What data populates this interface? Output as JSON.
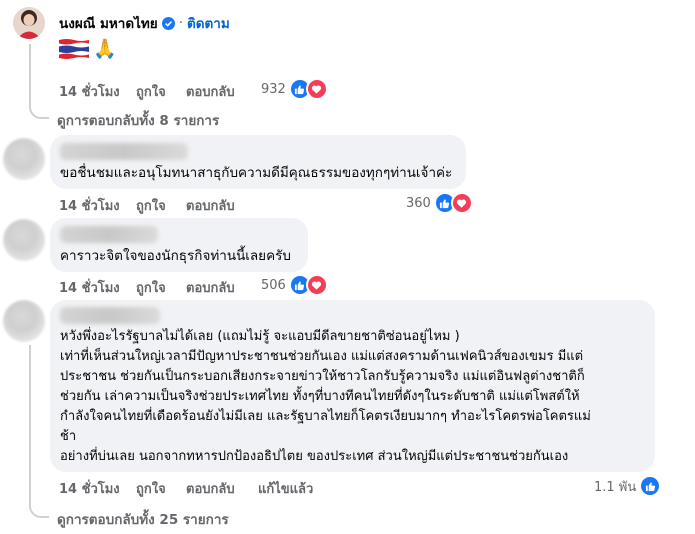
{
  "top_comment": {
    "author": "นงผณี มหาดไทย",
    "follow_label": "ติดตาม",
    "separator": "·",
    "emoji_text": "🙏",
    "time": "14 ชั่วโมง",
    "like_label": "ถูกใจ",
    "reply_label": "ตอบกลับ",
    "reactions_count": "932",
    "view_replies": "ดูการตอบกลับทั้ง 8 รายการ"
  },
  "replies": [
    {
      "text": "ขอชื่นชมและอนุโมทนาสาธุกับความดีมีคุณธรรมของทุกๆท่านเจ้าค่ะ",
      "time": "14 ชั่วโมง",
      "like_label": "ถูกใจ",
      "reply_label": "ตอบกลับ",
      "reactions_count": "360"
    },
    {
      "text": "คาราวะจิตใจของนักธุรกิจท่านนี้เลยครับ",
      "time": "14 ชั่วโมง",
      "like_label": "ถูกใจ",
      "reply_label": "ตอบกลับ",
      "reactions_count": "506"
    },
    {
      "lines": [
        "หวังพึ่งอะไรรัฐบาลไม่ได้เลย (แถมไม่รู้ จะแอบมีดีลขายชาติซ่อนอยู่ไหม )",
        "เท่าที่เห็นส่วนใหญ่เวลามีปัญหาประชาชนช่วยกันเอง แม่แต่สงครามด้านเฟคนิวส์ของเขมร มีแต่",
        "ประชาชน ช่วยกันเป็นกระบอกเสียงกระจายข่าวให้ชาวโลกรับรู้ความจริง แม่แต่อินฟลูต่างชาติก็",
        "ช่วยกัน เล่าความเป็นจริงช่วยประเทศไทย ทั้งๆที่บางทีคนไทยที่ดังๆในระดับชาติ แม่แต่โพสต์ให้",
        "กำลังใจคนไทยที่เดือดร้อนยังไม่มีเลย และรัฐบาลไทยก็โคตรเงียบมากๆ ทำอะไรโคตรพ่อโคตรแม่",
        "ช้า",
        "อย่างที่บ่นเลย นอกจากทหารปกป้องอธิปไตย ของประเทศ ส่วนใหญ่มีแต่ประชาชนช่วยกันเอง"
      ],
      "time": "14 ชั่วโมง",
      "like_label": "ถูกใจ",
      "reply_label": "ตอบกลับ",
      "edited_label": "แก้ไขแล้ว",
      "reactions_count": "1.1 พัน"
    }
  ],
  "bottom_view_replies": "ดูการตอบกลับทั้ง 25 รายการ",
  "colors": {
    "like": "#1877f2",
    "love": "#f33e58",
    "meta": "#65676b",
    "bubble": "#f0f2f5",
    "verified": "#1877f2"
  }
}
